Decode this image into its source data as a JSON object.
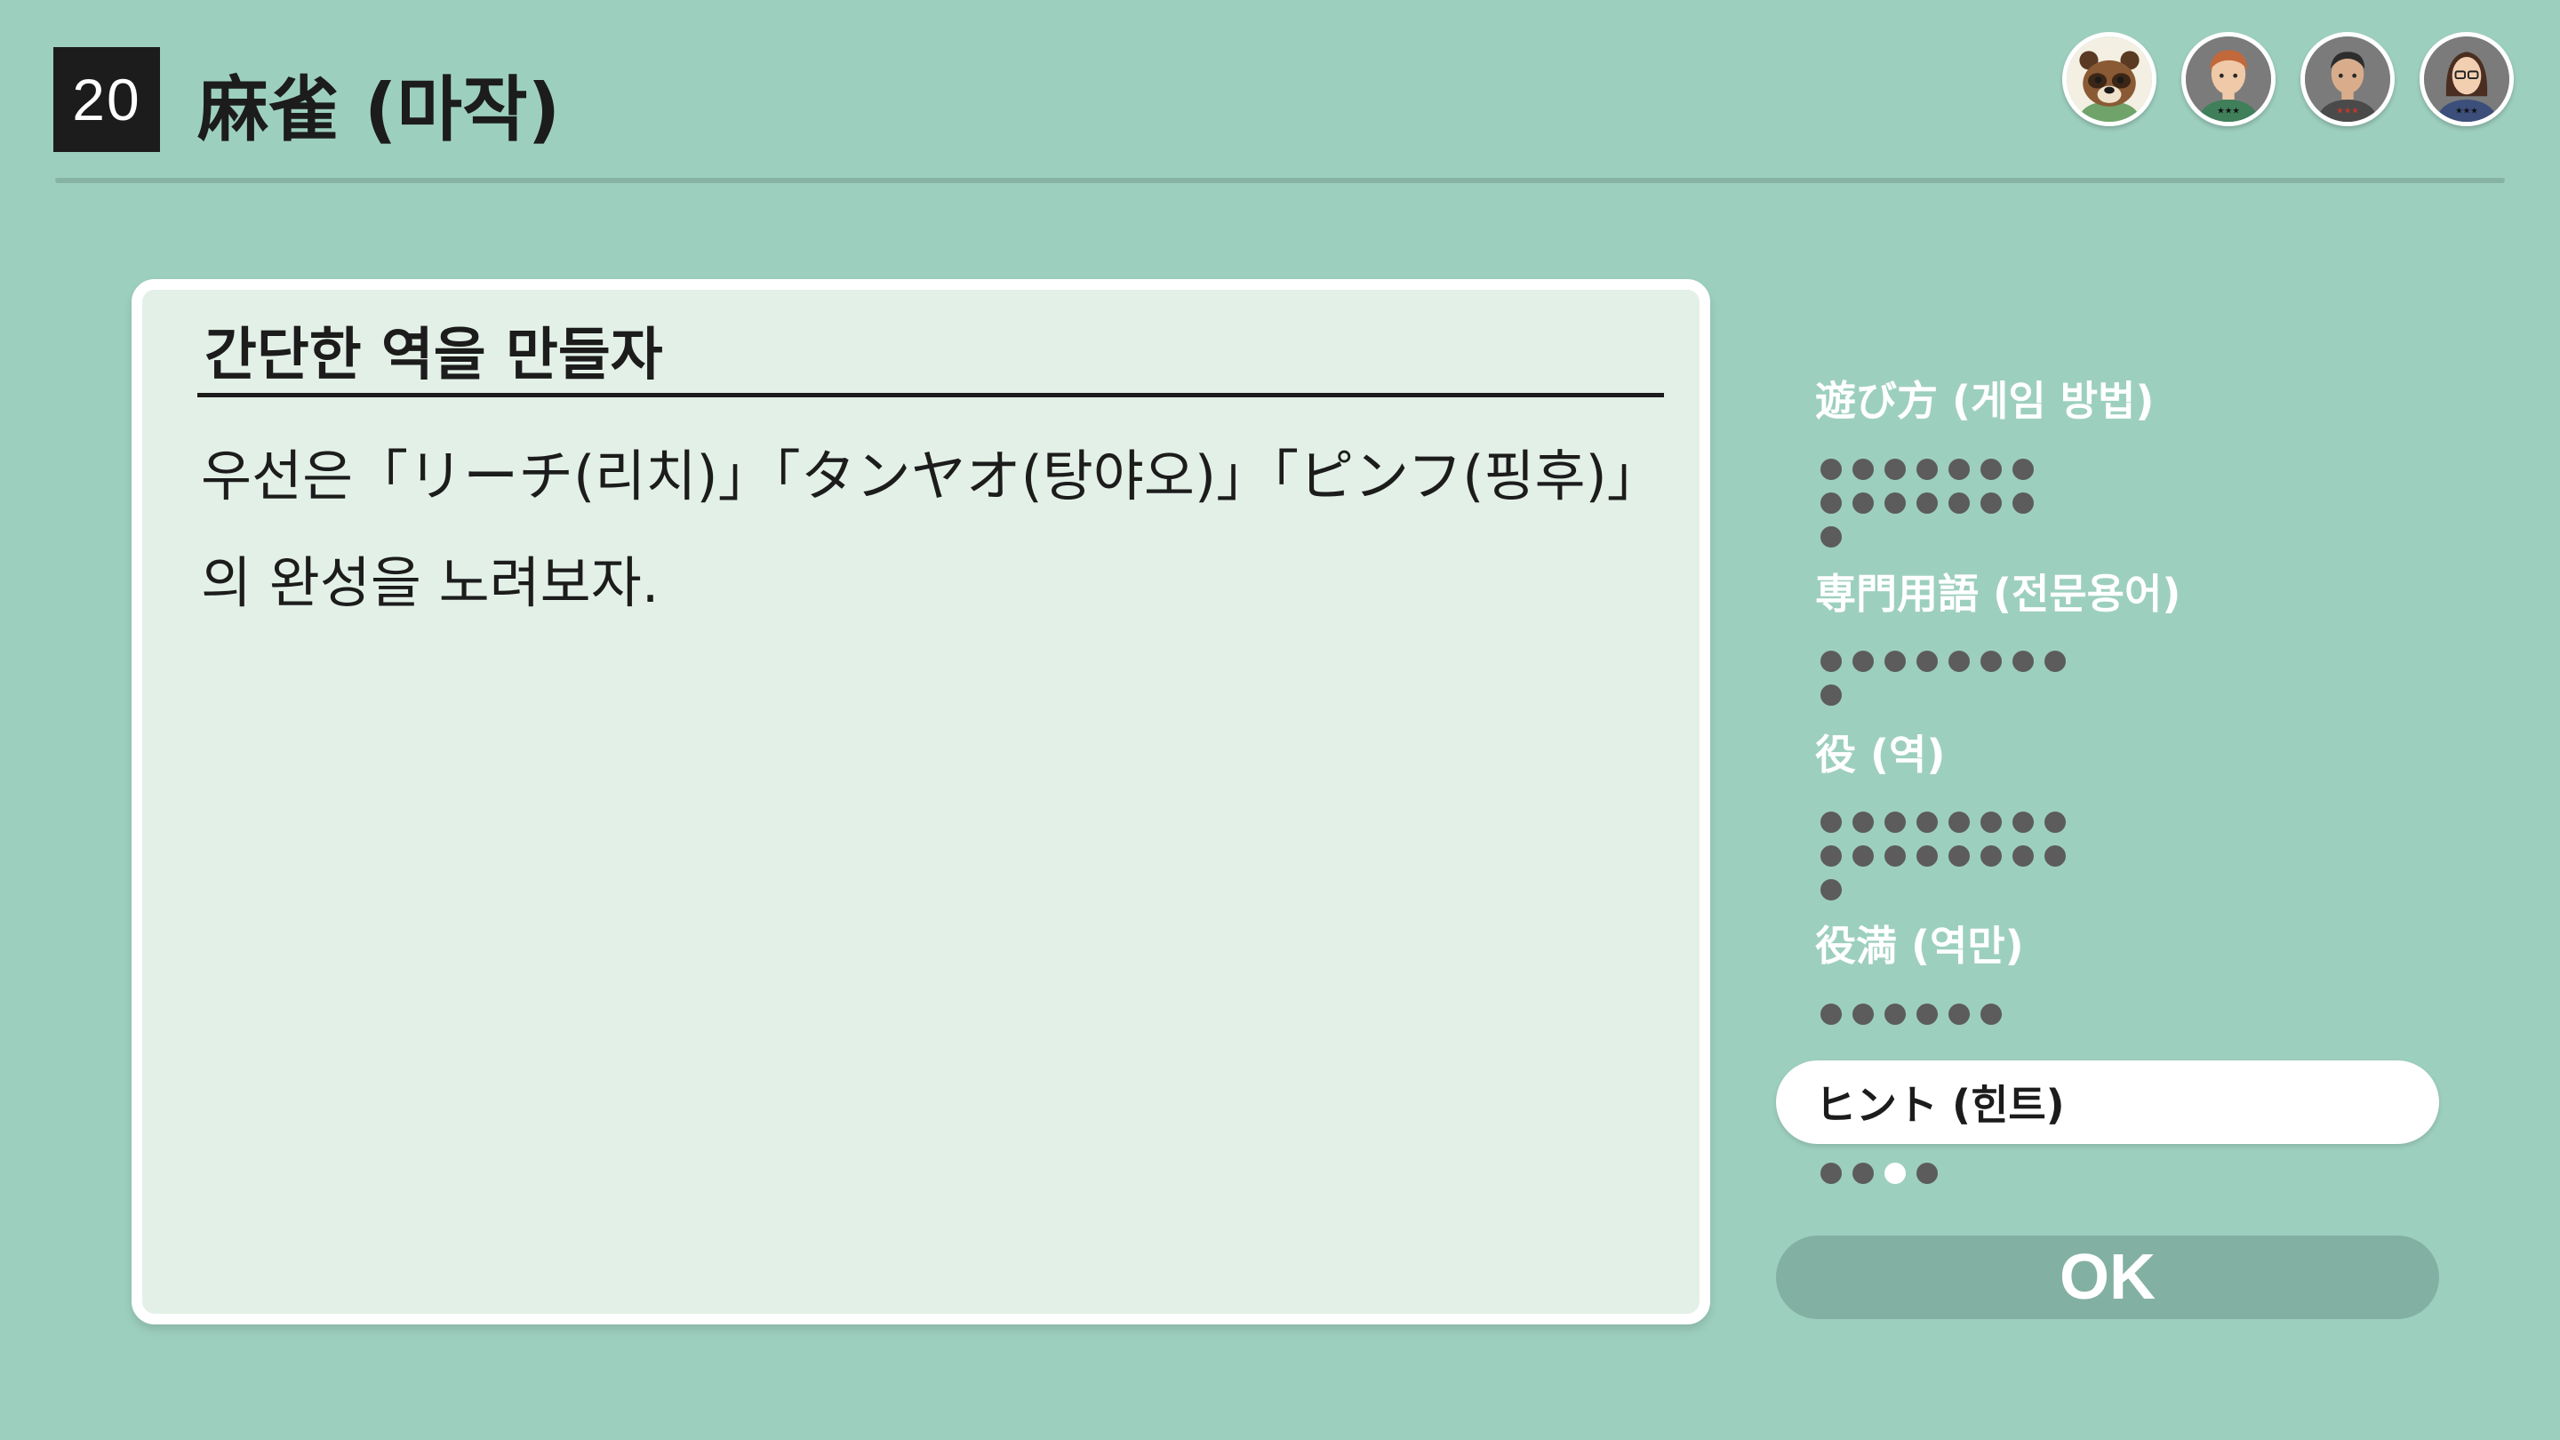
{
  "header": {
    "game_number": "20",
    "game_title": "麻雀 (마작)"
  },
  "players": [
    {
      "name": "tanuki-avatar"
    },
    {
      "name": "player-avatar"
    },
    {
      "name": "player-avatar"
    },
    {
      "name": "player-avatar"
    }
  ],
  "panel": {
    "title": "간단한 역을 만들자",
    "body_lines": [
      "우선은「リーチ(리치)」「タンヤオ(탕야오)」「ピンフ(핑후)」",
      "의 완성을 노려보자."
    ]
  },
  "menu": {
    "categories": [
      {
        "label": "遊び方 (게임 방법)",
        "pages": 15
      },
      {
        "label": "専門用語 (전문용어)",
        "pages": 9
      },
      {
        "label": "役 (역)",
        "pages": 17
      },
      {
        "label": "役満 (역만)",
        "pages": 6
      },
      {
        "label": "ヒント (힌트)",
        "pages": 4,
        "current_page": 3,
        "selected": true
      }
    ],
    "ok_label": "OK"
  },
  "colors": {
    "background": "#9dcfbf",
    "panel": "#e3f0e7",
    "ok_button": "#82b0a2",
    "dot": "#5c5c5c",
    "dot_current": "#ffffff"
  }
}
